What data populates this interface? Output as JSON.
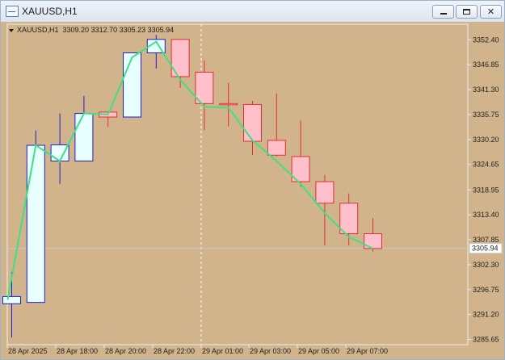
{
  "window": {
    "title": "XAUUSD,H1"
  },
  "info": {
    "symbol": "XAUUSD,H1",
    "ohlc": "3309.20 3312.70 3305.23 3305.94"
  },
  "colors": {
    "bg": "#d2b48c",
    "bull_border": "#1e1ecc",
    "bull_fill": "#e8ffff",
    "bear_border": "#e03030",
    "bear_fill": "#ffc0cb",
    "ma": "#40e080"
  },
  "chart_data": {
    "type": "candlestick",
    "ylim": [
      3285.65,
      3355.0
    ],
    "y_ticks": [
      3352.4,
      3346.85,
      3341.3,
      3335.75,
      3330.2,
      3324.65,
      3318.95,
      3313.4,
      3307.85,
      3302.3,
      3296.75,
      3291.2,
      3285.65
    ],
    "y_tick_labels": [
      "3352.40",
      "3346.85",
      "3341.30",
      "3335.75",
      "3330.20",
      "3324.65",
      "3318.95",
      "3313.40",
      "3307.85",
      "3302.30",
      "3296.75",
      "3291.20",
      "3285.65"
    ],
    "current_price": "3305.94",
    "x_labels": [
      "28 Apr 2025",
      "28 Apr 18:00",
      "28 Apr 20:00",
      "28 Apr 22:00",
      "29 Apr 01:00",
      "29 Apr 03:00",
      "29 Apr 05:00",
      "29 Apr 07:00"
    ],
    "candles": [
      {
        "o": 3293.6,
        "h": 3300.7,
        "l": 3286.1,
        "c": 3295.2
      },
      {
        "o": 3293.9,
        "h": 3332.2,
        "l": 3293.9,
        "c": 3328.9
      },
      {
        "o": 3325.4,
        "h": 3336.0,
        "l": 3320.3,
        "c": 3329.0
      },
      {
        "o": 3325.4,
        "h": 3339.9,
        "l": 3325.4,
        "c": 3336.0
      },
      {
        "o": 3336.3,
        "h": 3336.3,
        "l": 3333.0,
        "c": 3335.2
      },
      {
        "o": 3335.2,
        "h": 3349.5,
        "l": 3335.2,
        "c": 3349.5
      },
      {
        "o": 3349.5,
        "h": 3353.5,
        "l": 3346.0,
        "c": 3352.5
      },
      {
        "o": 3352.5,
        "h": 3352.5,
        "l": 3341.7,
        "c": 3344.2
      },
      {
        "o": 3345.2,
        "h": 3347.8,
        "l": 3332.3,
        "c": 3338.2
      },
      {
        "o": 3338.2,
        "h": 3342.8,
        "l": 3333.1,
        "c": 3338.0
      },
      {
        "o": 3338.0,
        "h": 3338.8,
        "l": 3326.7,
        "c": 3329.8
      },
      {
        "o": 3330.0,
        "h": 3340.5,
        "l": 3326.4,
        "c": 3326.7
      },
      {
        "o": 3326.4,
        "h": 3334.4,
        "l": 3319.7,
        "c": 3320.8
      },
      {
        "o": 3320.8,
        "h": 3322.3,
        "l": 3306.6,
        "c": 3316.0
      },
      {
        "o": 3316.0,
        "h": 3318.2,
        "l": 3306.6,
        "c": 3309.2
      },
      {
        "o": 3309.2,
        "h": 3312.7,
        "l": 3305.2,
        "c": 3305.9
      }
    ],
    "ma": [
      3294.5,
      3328.9,
      3325.4,
      3336.0,
      3335.8,
      3348.5,
      3352.0,
      3343.5,
      3337.5,
      3337.3,
      3330.0,
      3325.4,
      3320.3,
      3313.8,
      3308.5,
      3305.9
    ]
  }
}
